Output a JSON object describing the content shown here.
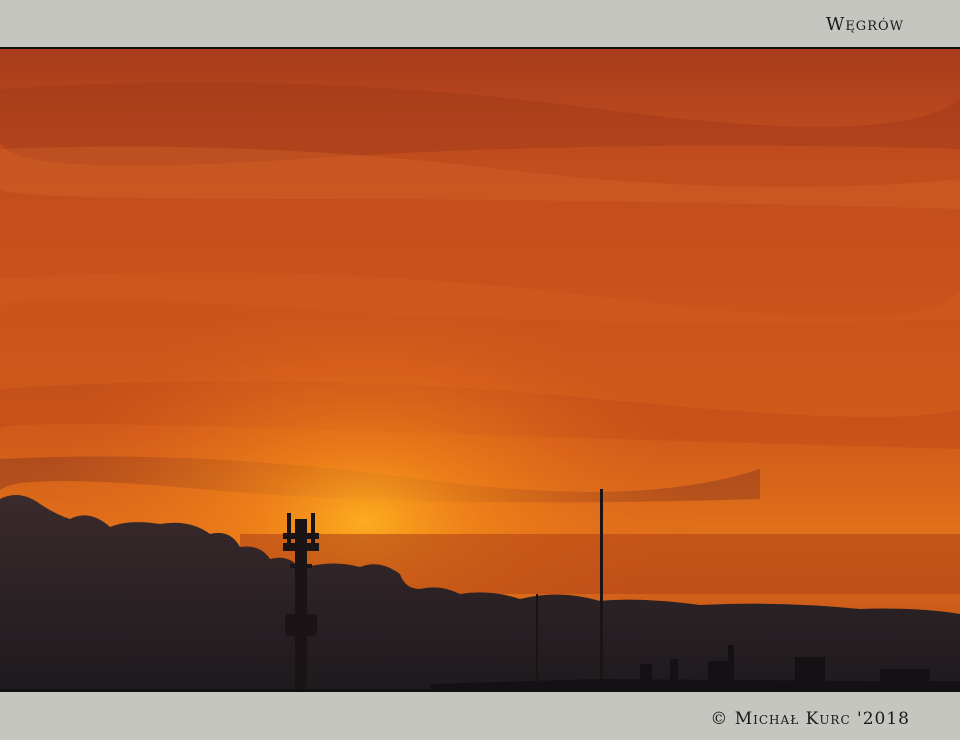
{
  "header": {
    "title": "Węgrów"
  },
  "footer": {
    "credit": "© Michał Kurc '2018"
  },
  "photo": {
    "subject": "sunset-sky",
    "colors": {
      "sky_top": "#b8401a",
      "sky_mid": "#c8501a",
      "glow": "#f58a18",
      "cloud": "#2b2125",
      "silhouette": "#1a1416"
    }
  }
}
